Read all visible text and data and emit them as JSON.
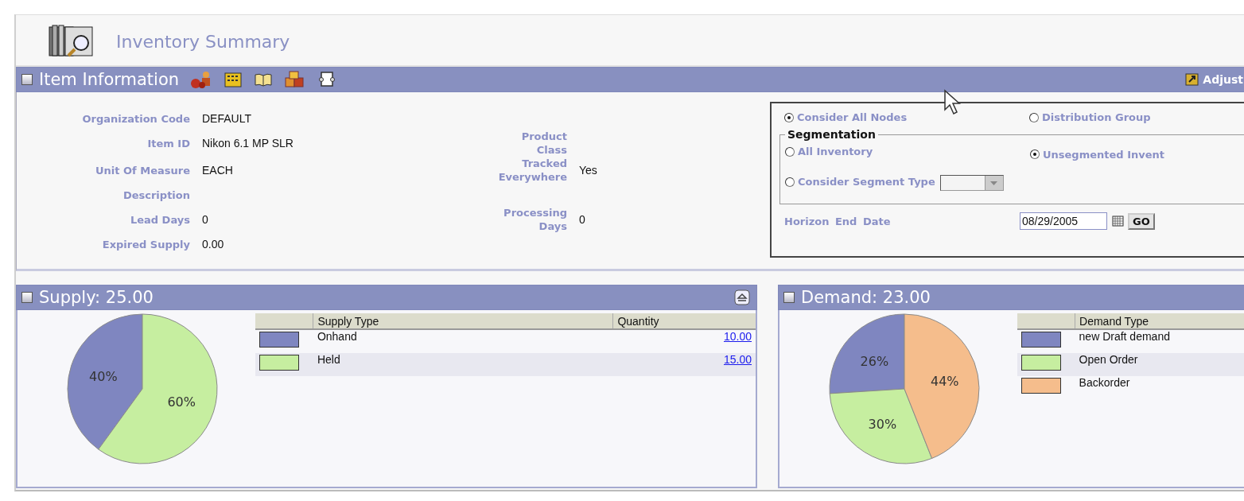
{
  "page": {
    "title": "Inventory Summary"
  },
  "item_information": {
    "title": "Item Information",
    "adjust_link": "Adjust",
    "rows": [
      [
        {
          "label": "Organization Code",
          "value": "DEFAULT"
        }
      ],
      [
        {
          "label": "Item ID",
          "value": "Nikon 6.1 MP SLR"
        },
        {
          "label": "Product Class"
        }
      ],
      [
        {
          "label": "Unit Of Measure",
          "value": "EACH"
        },
        {
          "label": "Tracked Everywhere",
          "value": "Yes"
        }
      ],
      [
        {
          "label": "Description"
        }
      ],
      [
        {
          "label": "Lead Days",
          "value": "0"
        },
        {
          "label": "Processing Days",
          "value": "0"
        }
      ],
      [
        {
          "label": "Expired Supply",
          "value": "0.00"
        }
      ]
    ]
  },
  "query": {
    "node_scope": [
      {
        "label": "Consider All Nodes",
        "selected": true
      },
      {
        "label": "Distribution Group",
        "selected": false
      }
    ],
    "segmentation": {
      "title": "Segmentation",
      "options": [
        {
          "label": "All Inventory",
          "selected": false
        },
        {
          "label": "Unsegmented Invent",
          "selected": true
        },
        {
          "label": "Consider Segment Type",
          "selected": false
        }
      ]
    },
    "horizon": {
      "label": "Horizon End Date",
      "value": "08/29/2005",
      "button": "GO"
    }
  },
  "supply": {
    "title": "Supply: 25.00",
    "columns": [
      "Supply Type",
      "Quantity"
    ],
    "rows": [
      {
        "quantity": "10.00",
        "color": "#7f86c0"
      },
      {
        "quantity": "15.00",
        "color": "#c6eea0"
      }
    ],
    "chart_data": {
      "type": "pie",
      "categories": [
        "Onhand",
        "Held"
      ],
      "values": [
        40,
        60
      ],
      "value_labels": [
        "40%",
        "60%"
      ]
    }
  },
  "demand": {
    "title": "Demand: 23.00",
    "columns": [
      "Demand Type"
    ],
    "rows": [
      {
        "color": "#7f86c0"
      },
      {
        "color": "#c6eea0"
      },
      {
        "color": "#f5bd8c"
      }
    ],
    "chart_data": {
      "type": "pie",
      "categories": [
        "new Draft demand",
        "Open Order",
        "Backorder"
      ],
      "values": [
        26,
        30,
        44
      ],
      "value_labels": [
        "26%",
        "30%",
        "44%"
      ]
    }
  }
}
